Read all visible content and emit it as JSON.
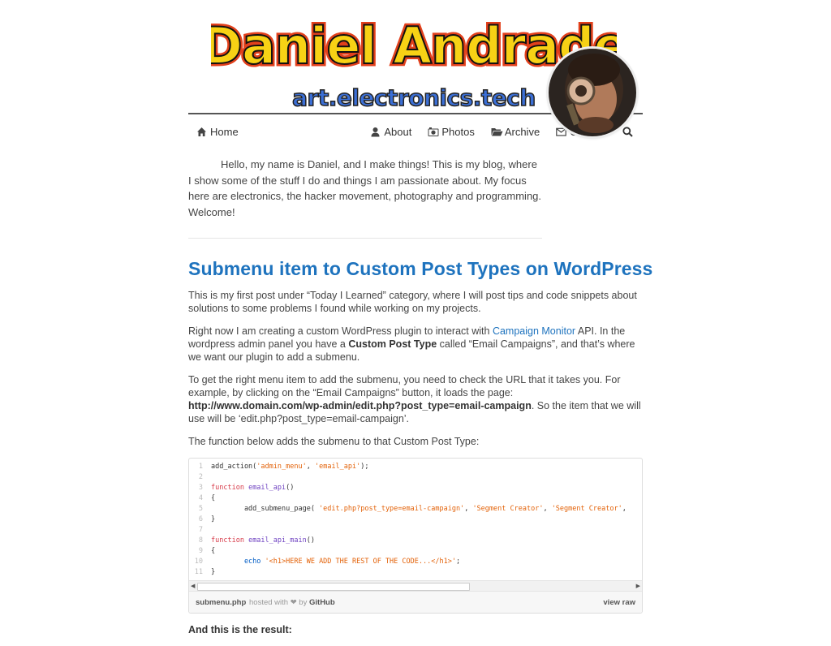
{
  "site": {
    "logo_name": "Daniel Andrade",
    "logo_tagline": "art.electronics.tech"
  },
  "nav": {
    "home": "Home",
    "about": "About",
    "photos": "Photos",
    "archive": "Archive",
    "contact": "Contact"
  },
  "intro": {
    "text": "Hello, my name is Daniel, and I make things! This is my blog, where I show some of the stuff I do and things I am passionate about. My focus here are electronics, the hacker movement, photography and programming. Welcome!"
  },
  "post": {
    "title": "Submenu item to Custom Post Types on WordPress",
    "p1": "This is my first post under “Today I Learned” category, where I will post tips and code snippets about solutions to some problems I found while working on my projects.",
    "p2_a": "Right now I am creating a custom WordPress plugin to interact with ",
    "p2_link": "Campaign Monitor",
    "p2_b": " API. In the wordpress admin panel you have a ",
    "p2_bold": "Custom Post Type",
    "p2_c": " called “Email Campaigns”, and that’s where we want our plugin to add a submenu.",
    "p3_a": "To get the right menu item to add the submenu, you need to check the URL that it takes you. For example, by clicking on the “Email Campaigns” button, it loads the page: ",
    "p3_bold": "http://www.domain.com/wp-admin/edit.php?post_type=email-campaign",
    "p3_b": ". So the item that we will use will be ‘edit.php?post_type=email-campaign’.",
    "p4": "The function below adds the submenu to that Custom Post Type:",
    "p5": "And this is the result:"
  },
  "gist": {
    "line_numbers": [
      "1",
      "2",
      "3",
      "4",
      "5",
      "6",
      "7",
      "8",
      "9",
      "10",
      "11"
    ],
    "l1_a": "add_action(",
    "l1_s1": "'admin_menu'",
    "l1_b": ", ",
    "l1_s2": "'email_api'",
    "l1_c": ");",
    "l3_kw": "function",
    "l3_fn": " email_api",
    "l3_b": "()",
    "l4": "{",
    "l5_a": "        add_submenu_page( ",
    "l5_s1": "'edit.php?post_type=email-campaign'",
    "l5_b": ", ",
    "l5_s2": "'Segment Creator'",
    "l5_c": ", ",
    "l5_s3": "'Segment Creator'",
    "l5_d": ",",
    "l6": "}",
    "l8_kw": "function",
    "l8_fn": " email_api_main",
    "l8_b": "()",
    "l9": "{",
    "l10_ec": "        echo",
    "l10_s": " '<h1>HERE WE ADD THE REST OF THE CODE...</h1>'",
    "l10_c": ";",
    "l11": "}",
    "filename": "submenu.php",
    "hosted": "hosted with ❤ by",
    "github": "GitHub",
    "view_raw": "view raw"
  },
  "colors": {
    "link": "#1e73be",
    "text": "#444444",
    "rule": "#555555"
  },
  "icons": [
    "home-icon",
    "user-icon",
    "camera-icon",
    "folder-icon",
    "envelope-icon",
    "search-icon"
  ]
}
